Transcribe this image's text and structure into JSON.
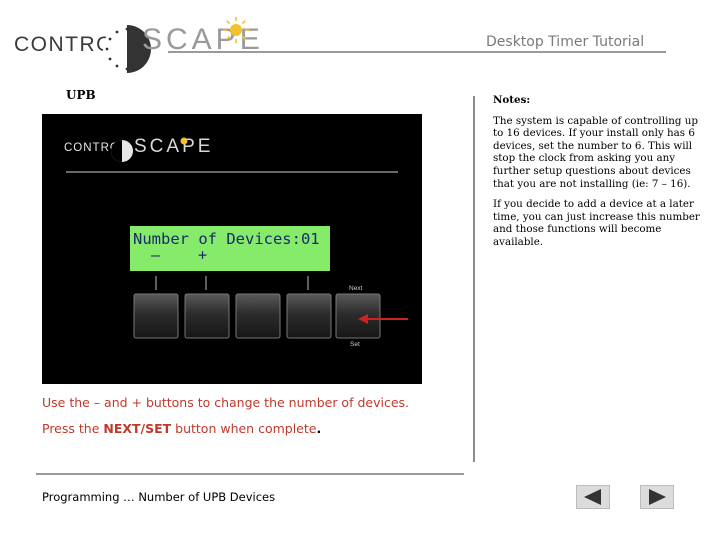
{
  "logo": {
    "word1": "CONTROL",
    "word2": "SCAPE"
  },
  "header": {
    "tutorial_title": "Desktop Timer Tutorial"
  },
  "section_label": "UPB",
  "device_screen": {
    "lcd": {
      "line1": "Number of Devices:01",
      "minus": "–",
      "plus": "+"
    },
    "next_label": "Next",
    "set_label": "Set",
    "soft_buttons": [
      "button-1",
      "button-2",
      "button-3",
      "button-4",
      "button-5"
    ],
    "arrow_color": "#cc2222"
  },
  "notes": {
    "title": "Notes:",
    "paragraphs": [
      "The system is capable of controlling up to 16 devices. If your install only has 6 devices, set the number to 6. This will stop the clock from asking you any further setup questions about devices that you are not installing (ie: 7 – 16).",
      "If you decide to add a device at a later time, you can just increase this number and those functions will become available."
    ]
  },
  "instructions": {
    "line1": "Use the – and + buttons to change the number of devices.",
    "line2_prefix": "Press the ",
    "line2_bold": "NEXT/SET",
    "line2_suffix": " button when complete",
    "line2_end": "."
  },
  "footer": {
    "text": "Programming … Number of UPB Devices"
  },
  "colors": {
    "accent_red": "#c0392b",
    "lcd_green": "#86ea6a",
    "sun_yellow": "#f2c12e"
  }
}
